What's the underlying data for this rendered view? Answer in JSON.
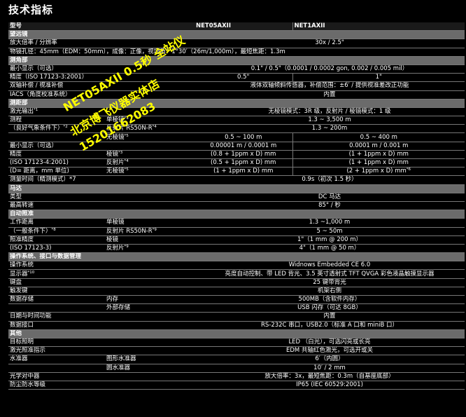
{
  "page": {
    "title": "技术指标"
  },
  "header": {
    "col1": "型号",
    "model_a": "NET05AXII",
    "model_b": "NET1AXII"
  },
  "sections": {
    "telescope": "望远镜",
    "angle": "测角部",
    "distance": "测距部",
    "motor": "马达",
    "tracking": "自动照准",
    "system": "操作系统、接口与数据管理",
    "other": "其他"
  },
  "rows": {
    "r1": {
      "label": "放大倍率 / 分辨率",
      "value": "30x / 2.5\""
    },
    "r2": {
      "label": "物镜孔径：45mm（EDM：50mm），成像：正像，视场角：1°30′（26m/1,000m），最短焦距：1.3m"
    },
    "r3": {
      "label": "最小显示（可选）",
      "value": "0.1\" / 0.5\"（0.0001 / 0.0002 gon, 0.002 / 0.005 mil）"
    },
    "r4": {
      "label": "精度（ISO 17123-3:2001）",
      "a": "0.5\"",
      "b": "1\""
    },
    "r5": {
      "label": "双轴补偿 / 视准补偿",
      "value": "液体双轴倾斜传感器，补偿范围：±6′ / 提供视准差改正功能"
    },
    "r6": {
      "label": "IACS（角度校准系统）",
      "value": "内置"
    },
    "r7": {
      "label": "激光输出",
      "sup": "*1",
      "value": "无棱镜模式：3R 级，反射片 / 棱镜模式：1 级"
    },
    "r8": {
      "label": "测程",
      "sub": "单棱镜",
      "sup2": "*3",
      "value": "1.3 ~ 3,500 m"
    },
    "r9": {
      "label": "（良好气象条件下）",
      "sup": "*2",
      "sub": "反射片 RS50N-R",
      "sup2": "*4",
      "value": "1.3 ~ 200m"
    },
    "r10": {
      "sub": "无棱镜",
      "sup2": "*5",
      "a": "0.5 ~ 100 m",
      "b": "0.5 ~ 400 m"
    },
    "r11": {
      "label": "最小显示（可选）",
      "a": "0.00001 m / 0.0001 m",
      "b": "0.0001 m / 0.001 m"
    },
    "r12": {
      "label": "精度",
      "sub": "棱镜",
      "sup2": "*3",
      "a": "(0.8 + 1ppm x D) mm",
      "b": "(1 + 1ppm x D) mm"
    },
    "r13": {
      "label": "(ISO 17123-4:2001)",
      "sub": "反射片",
      "sup2": "*4",
      "a": "(0.5 + 1ppm x D) mm",
      "b": "(1 + 1ppm x D) mm"
    },
    "r14": {
      "label": "(D= 距离，mm 单位)",
      "sub": "无棱镜",
      "sup2": "*5",
      "a": "(1 + 1ppm x D) mm",
      "b": "(2 + 1ppm x D) mm",
      "sup3": "*6"
    },
    "r15": {
      "label": "测量时间（精测模式）*7",
      "value": "0.9s（初次 1.5 秒）"
    },
    "r16": {
      "label": "类型",
      "value": "DC 马达"
    },
    "r17": {
      "label": "最高转速",
      "value": "85° / 秒"
    },
    "r18": {
      "label": "工作距离",
      "sub": "单棱镜",
      "value": "1.3 ~1,000 m"
    },
    "r19": {
      "label": "（一般条件下）",
      "sup": "*8",
      "sub": "反射片 RS50N-R",
      "sup2": "*9",
      "value": "5 ~ 50m"
    },
    "r20": {
      "label": "照准精度",
      "sub": "棱镜",
      "value": "1\"（1 mm @ 200 m）"
    },
    "r21": {
      "label": "(ISO 17123-3)",
      "sub": "反射片",
      "sup2": "*9",
      "value": "4\"（1 mm @ 50 m）"
    },
    "r22": {
      "label": "操作系统",
      "value": "Widnows Embedded CE 6.0"
    },
    "r23": {
      "label": "显示器",
      "sup": "*10",
      "value": "亮度自动控制、带 LED 背光、3.5 英寸透射式 TFT  QVGA 彩色液晶触摸显示器"
    },
    "r24": {
      "label": "键盘",
      "value": "25 键带背光"
    },
    "r25": {
      "label": "触发键",
      "value": "机架右侧"
    },
    "r26": {
      "label": "数据存储",
      "sub": "内存",
      "value": "500MB（含软件内存）"
    },
    "r27": {
      "sub": "外部存储",
      "value": "USB 闪存（可达 8GB）"
    },
    "r28": {
      "label": "日期与时间功能",
      "value": "内置"
    },
    "r29": {
      "label": "数据接口",
      "value": "RS-232C 串口，USB2.0（标准 A 口和 miniB 口）"
    },
    "r30": {
      "label": "目标照明",
      "value": "LED （白光），可选闪亮或长亮"
    },
    "r31": {
      "label": "激光照准指示",
      "value": "EDM 共轴红色激光，可选开或关"
    },
    "r32": {
      "label": "水准器",
      "sub": "图形水准器",
      "value": "6′（内圆）"
    },
    "r33": {
      "sub": "圆水准器",
      "value": "10′ / 2 mm"
    },
    "r34": {
      "label": "光学对中器",
      "value": "放大倍率：3x，最短焦距：0.3m（自基座底部）"
    },
    "r35": {
      "label": "防尘防水等级",
      "value": "IP65 (IEC 60529:2001)"
    }
  },
  "watermark": {
    "line1": "NET05AXII 0.5秒 全站仪",
    "line2": "北京博飞仪器实体店",
    "line3": "15201662083"
  },
  "colors": {
    "background": "#000000",
    "section_bar": "#6b6b6b",
    "watermark": "#ffff00"
  }
}
